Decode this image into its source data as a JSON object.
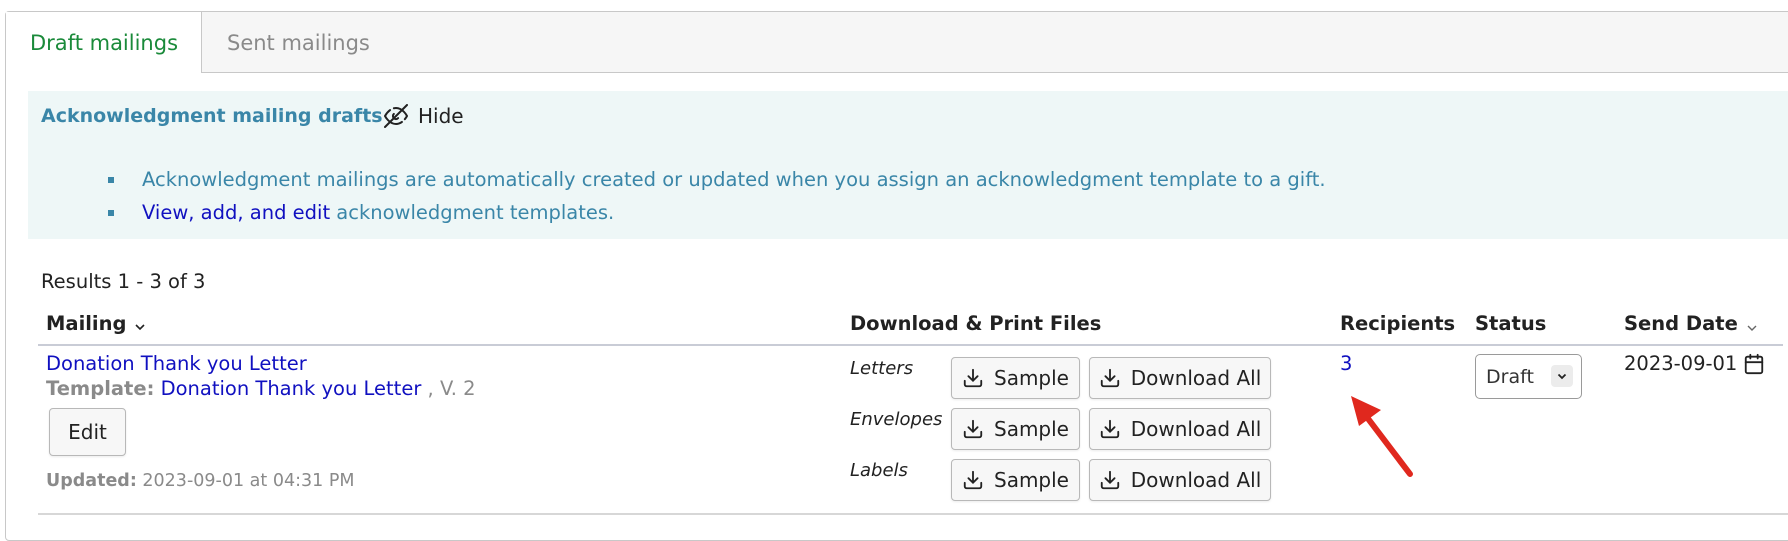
{
  "tabs": [
    {
      "label": "Draft mailings",
      "active": true
    },
    {
      "label": "Sent mailings",
      "active": false
    }
  ],
  "info": {
    "title": "Acknowledgment mailing drafts",
    "hide_label": "Hide",
    "bullet1": "Acknowledgment mailings are automatically created or updated when you assign an acknowledgment template to a gift.",
    "bullet2_link": "View, add, and edit",
    "bullet2_rest": " acknowledgment templates."
  },
  "results": {
    "label": "Results 1 - 3 of 3"
  },
  "table": {
    "headers": {
      "mailing": "Mailing",
      "files": "Download & Print Files",
      "recipients": "Recipients",
      "status": "Status",
      "send_date": "Send Date"
    },
    "row": {
      "name": "Donation Thank you Letter",
      "template_label": "Template:",
      "template_name": "Donation Thank you Letter",
      "template_version": " , V. 2",
      "edit_label": "Edit",
      "updated_label": "Updated:",
      "updated_value": " 2023-09-01 at 04:31 PM",
      "files": [
        {
          "type": "Letters",
          "sample": "Sample",
          "download": "Download All"
        },
        {
          "type": "Envelopes",
          "sample": "Sample",
          "download": "Download All"
        },
        {
          "type": "Labels",
          "sample": "Sample",
          "download": "Download All"
        }
      ],
      "recipients": "3",
      "status": "Draft",
      "send_date": "2023-09-01"
    }
  },
  "colors": {
    "active_tab": "#1a8a3a",
    "info_bg": "#eef7f7",
    "info_text": "#3a86a8",
    "link": "#1010c0",
    "annotation_arrow": "#e0281e"
  },
  "icons": {
    "hide": "eye-off-icon",
    "download": "download-icon",
    "calendar": "calendar-icon",
    "sort": "chevron-down-icon"
  }
}
